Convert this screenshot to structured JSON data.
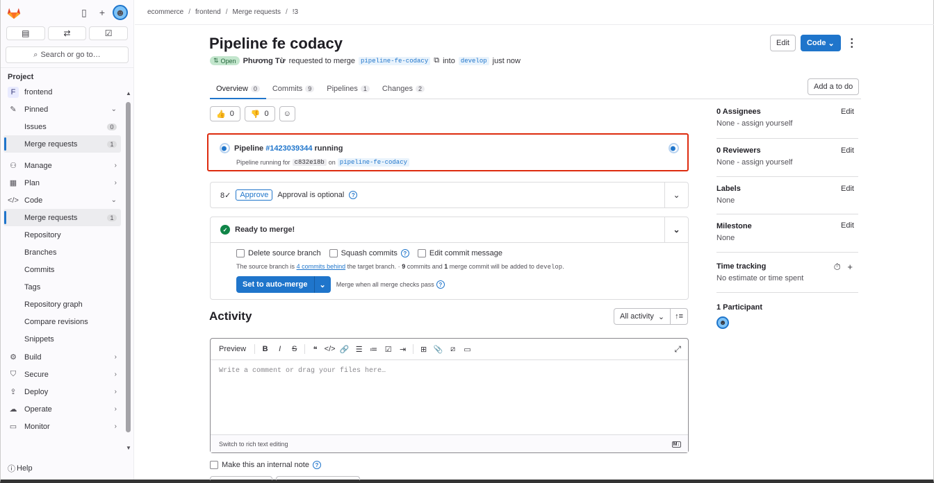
{
  "sidebar": {
    "search_label": "Search or go to…",
    "section": "Project",
    "project_letter": "F",
    "project_name": "frontend",
    "pinned": "Pinned",
    "pinned_items": [
      {
        "label": "Issues",
        "count": "0"
      },
      {
        "label": "Merge requests",
        "count": "1"
      }
    ],
    "groups": [
      {
        "label": "Manage"
      },
      {
        "label": "Plan"
      },
      {
        "label": "Code"
      }
    ],
    "code_items": [
      {
        "label": "Merge requests",
        "count": "1"
      },
      {
        "label": "Repository"
      },
      {
        "label": "Branches"
      },
      {
        "label": "Commits"
      },
      {
        "label": "Tags"
      },
      {
        "label": "Repository graph"
      },
      {
        "label": "Compare revisions"
      },
      {
        "label": "Snippets"
      }
    ],
    "more_groups": [
      {
        "label": "Build"
      },
      {
        "label": "Secure"
      },
      {
        "label": "Deploy"
      },
      {
        "label": "Operate"
      },
      {
        "label": "Monitor"
      }
    ],
    "help": "Help"
  },
  "breadcrumb": [
    "ecommerce",
    "frontend",
    "Merge requests",
    "!3"
  ],
  "mr": {
    "title": "Pipeline fe codacy",
    "edit": "Edit",
    "code": "Code",
    "status": "Open",
    "author": "Phương Từ",
    "requested": "requested to merge",
    "source_branch": "pipeline-fe-codacy",
    "into": "into",
    "target_branch": "develop",
    "when": "just now"
  },
  "tabs": [
    {
      "label": "Overview",
      "count": "0"
    },
    {
      "label": "Commits",
      "count": "9"
    },
    {
      "label": "Pipelines",
      "count": "1"
    },
    {
      "label": "Changes",
      "count": "2"
    }
  ],
  "add_todo": "Add a to do",
  "reactions": {
    "up": "0",
    "down": "0"
  },
  "pipeline": {
    "prefix": "Pipeline",
    "id": "#1423039344",
    "status": "running",
    "line2": "Pipeline running for",
    "sha": "c832e18b",
    "on": "on",
    "branch": "pipeline-fe-codacy"
  },
  "approval": {
    "button": "Approve",
    "text": "Approval is optional"
  },
  "merge": {
    "title": "Ready to merge!",
    "opt1": "Delete source branch",
    "opt2": "Squash commits",
    "opt3": "Edit commit message",
    "note_a": "The source branch is",
    "note_link": "4 commits behind",
    "note_b": "the target branch. ·",
    "note_c": "9",
    "note_d": "commits and",
    "note_e": "1",
    "note_f": "merge commit will be added to",
    "note_g": "develop",
    "button": "Set to auto-merge",
    "hint": "Merge when all merge checks pass"
  },
  "activity": {
    "title": "Activity",
    "filter": "All activity"
  },
  "editor": {
    "preview": "Preview",
    "placeholder": "Write a comment or drag your files here…",
    "switch": "Switch to rich text editing",
    "internal": "Make this an internal note"
  },
  "right": {
    "assignees": "0 Assignees",
    "assignees_val": "None - assign yourself",
    "reviewers": "0 Reviewers",
    "reviewers_val": "None - assign yourself",
    "labels": "Labels",
    "labels_val": "None",
    "milestone": "Milestone",
    "milestone_val": "None",
    "time": "Time tracking",
    "time_val": "No estimate or time spent",
    "participants": "1 Participant",
    "edit": "Edit"
  },
  "colors": {
    "accent": "#1f75cb",
    "highlight": "#dd2b0e",
    "success": "#108548"
  }
}
